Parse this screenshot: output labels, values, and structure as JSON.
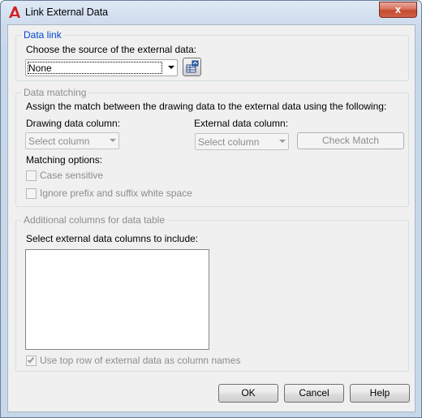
{
  "window": {
    "title": "Link External Data",
    "close_glyph": "x"
  },
  "data_link": {
    "legend": "Data link",
    "prompt": "Choose the source of the external data:",
    "source_value": "None"
  },
  "data_matching": {
    "legend": "Data matching",
    "description": "Assign the match between the drawing data to the external data using the following:",
    "drawing_column_label": "Drawing data column:",
    "drawing_column_value": "Select column",
    "external_column_label": "External data column:",
    "external_column_value": "Select column",
    "check_match_label": "Check Match",
    "matching_options_label": "Matching options:",
    "case_sensitive_label": "Case sensitive",
    "ignore_whitespace_label": "Ignore prefix and suffix white space"
  },
  "additional_columns": {
    "legend": "Additional columns for data table",
    "prompt": "Select external data columns to include:",
    "use_top_row_label": "Use top row of external data as column names"
  },
  "buttons": {
    "ok": "OK",
    "cancel": "Cancel",
    "help": "Help"
  },
  "colors": {
    "legend_accent": "#0046d5",
    "close_button": "#c44a2f"
  }
}
